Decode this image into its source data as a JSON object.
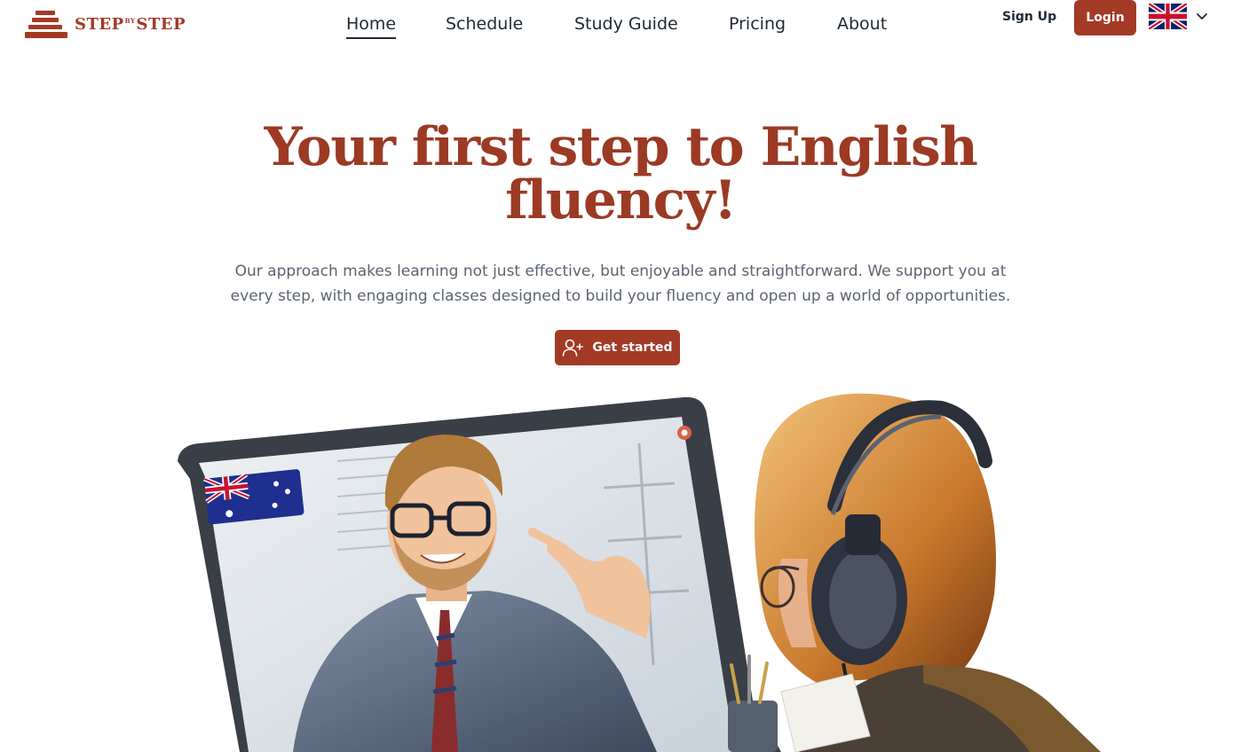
{
  "brand": {
    "name_part1": "STEP",
    "name_by": "BY",
    "name_part2": "STEP",
    "color": "#a33a26"
  },
  "nav": {
    "items": [
      {
        "label": "Home",
        "active": true
      },
      {
        "label": "Schedule",
        "active": false
      },
      {
        "label": "Study Guide",
        "active": false
      },
      {
        "label": "Pricing",
        "active": false
      },
      {
        "label": "About",
        "active": false
      }
    ]
  },
  "auth": {
    "signup_label": "Sign Up",
    "login_label": "Login"
  },
  "language": {
    "flag_icon": "uk-flag-icon",
    "dropdown_icon": "chevron-down-icon"
  },
  "hero": {
    "title_line1": "Your first step to English",
    "title_line2": "fluency!",
    "subtitle": "Our approach makes learning not just effective, but enjoyable and straightforward. We support you at every step, with engaging classes designed to build your fluency and open up a world of opportunities.",
    "cta_label": "Get started",
    "cta_icon": "user-plus-icon"
  },
  "colors": {
    "accent": "#a33a26",
    "title": "#9c3a24",
    "text": "#1f2937",
    "muted": "#5b6470"
  }
}
